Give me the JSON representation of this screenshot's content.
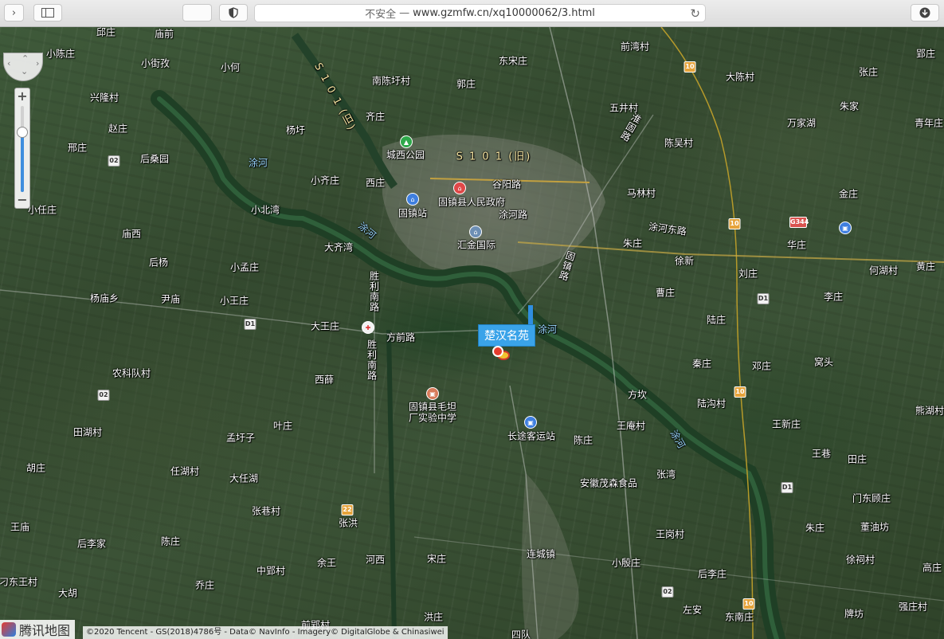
{
  "browser": {
    "security": "不安全",
    "separator": "—",
    "url": "www.gzmfw.cn/xq10000062/3.html"
  },
  "map": {
    "marker_title": "楚汉名苑",
    "logo_text": "腾讯地图",
    "copyright": "©2020 Tencent - GS(2018)4786号 - Data© NavInfo - Imagery© DigitalGlobe & Chinasiwei",
    "zoom_plus": "+",
    "zoom_minus": "−",
    "places": [
      "邱庄",
      "庙前",
      "小陈庄",
      "小街孜",
      "小何",
      "南陈圩村",
      "郭庄",
      "东宋庄",
      "前湾村",
      "郢庄",
      "大陈村",
      "张庄",
      "朱家",
      "青年庄",
      "兴隆村",
      "齐庄",
      "五井村",
      "万家湖",
      "赵庄",
      "杨圩",
      "邢庄",
      "后桑园",
      "陈吴村",
      "小齐庄",
      "西庄",
      "谷阳路",
      "马林村",
      "金庄",
      "固镇县人民政府",
      "固镇站",
      "涂河路",
      "小任庄",
      "小北湾",
      "庙西",
      "大齐湾",
      "汇金国际",
      "朱庄",
      "华庄",
      "何湖村",
      "黄庄",
      "后杨",
      "小孟庄",
      "徐新",
      "刘庄",
      "曹庄",
      "李庄",
      "杨庙乡",
      "尹庙",
      "小王庄",
      "大王庄",
      "方前路",
      "陆庄",
      "秦庄",
      "邓庄",
      "窝头",
      "农科队村",
      "西薛",
      "固镇县毛坦",
      "厂实验中学",
      "方坎",
      "陆沟村",
      "熊湖村",
      "叶庄",
      "长途客运站",
      "陈庄",
      "王庵村",
      "王新庄",
      "田湖村",
      "孟圩子",
      "王巷",
      "田庄",
      "胡庄",
      "任湖村",
      "大任湖",
      "张湾",
      "安徽茂森食品",
      "门东顾庄",
      "张巷村",
      "张洪",
      "王庙",
      "后李家",
      "陈庄",
      "王岗村",
      "朱庄",
      "董油坊",
      "余王",
      "河西",
      "宋庄",
      "连城镇",
      "小殷庄",
      "徐祠村",
      "高庄",
      "中郢村",
      "乔庄",
      "后李庄",
      "东南庄",
      "左安",
      "强庄村",
      "刁东王村",
      "大胡",
      "洪庄",
      "牌坊",
      "四队",
      "前郢村"
    ],
    "roads": {
      "s101_old": "S 1 0 1 (旧)",
      "s101_vertical": "S 1 0 1 (旧)",
      "tuhe_east": "涂河东路",
      "shengli_south": "胜利南路",
      "shengli_south_2": "胜利南路",
      "gumin": "固镇路",
      "huai": "淮固路",
      "zhongxing": "中兴路"
    },
    "water": [
      "涂河",
      "涂河",
      "涂河",
      "涂河"
    ],
    "poi": {
      "park": "城西公园"
    },
    "shields": [
      "02",
      "02",
      "D1",
      "02",
      "D1",
      "22",
      "D1",
      "D1",
      "D2",
      "10",
      "10",
      "10",
      "10",
      "G344"
    ]
  }
}
